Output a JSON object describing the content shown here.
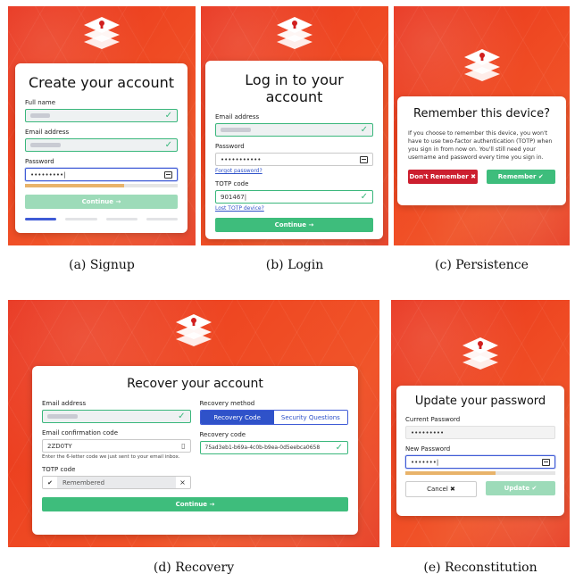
{
  "panels": {
    "signup": {
      "title": "Create your account",
      "labels": {
        "full_name": "Full name",
        "email": "Email address",
        "password": "Password"
      },
      "password_mask": "•••••••••|",
      "password_strength": 0.65,
      "continue_label": "Continue →",
      "caption": "(a) Signup",
      "active_step": 1,
      "total_steps": 4
    },
    "login": {
      "title": "Log in to your account",
      "labels": {
        "email": "Email address",
        "password": "Password",
        "totp": "TOTP code"
      },
      "password_mask": "•••••••••••",
      "forgot_password": "Forgot password?",
      "totp_value": "901467|",
      "lost_totp": "Lost TOTP device?",
      "continue_label": "Continue →",
      "caption": "(b) Login"
    },
    "persistence": {
      "title": "Remember this device?",
      "body": "If you choose to remember this device, you won't have to use two-factor authentication (TOTP) when you sign in from now on. You'll still need your username and password every time you sign in.",
      "dont_remember_label": "Don't Remember",
      "remember_label": "Remember",
      "caption": "(c) Persistence"
    },
    "recovery": {
      "title": "Recover your account",
      "labels": {
        "email": "Email address",
        "email_code": "Email confirmation code",
        "totp": "TOTP code",
        "method": "Recovery method",
        "recovery_code": "Recovery code"
      },
      "email_code_value": "2ZD0TY",
      "email_code_helper": "Enter the 6-letter code we just sent to your email inbox.",
      "totp_status": "Remembered",
      "method_options": [
        "Recovery Code",
        "Security Questions"
      ],
      "recovery_code_value": "75ad3eb1-b69a-4c0b-b9ea-0d5eebca0658",
      "continue_label": "Continue →",
      "caption": "(d) Recovery"
    },
    "reconstitution": {
      "title": "Update your password",
      "labels": {
        "current": "Current Password",
        "new": "New Password"
      },
      "current_mask": "•••••••••",
      "new_mask": "•••••••|",
      "password_strength": 0.6,
      "cancel_label": "Cancel",
      "update_label": "Update",
      "caption": "(e) Reconstitution"
    }
  },
  "colors": {
    "brand_red": "#e8321c",
    "success_green": "#3ebd7c",
    "primary_blue": "#2f52c9",
    "danger_red": "#cc1f2f"
  },
  "icons": {
    "logo": "layered-shield-keyhole-icon",
    "check": "check-icon",
    "keyboard": "keyboard-icon",
    "arrow": "arrow-right-icon"
  }
}
